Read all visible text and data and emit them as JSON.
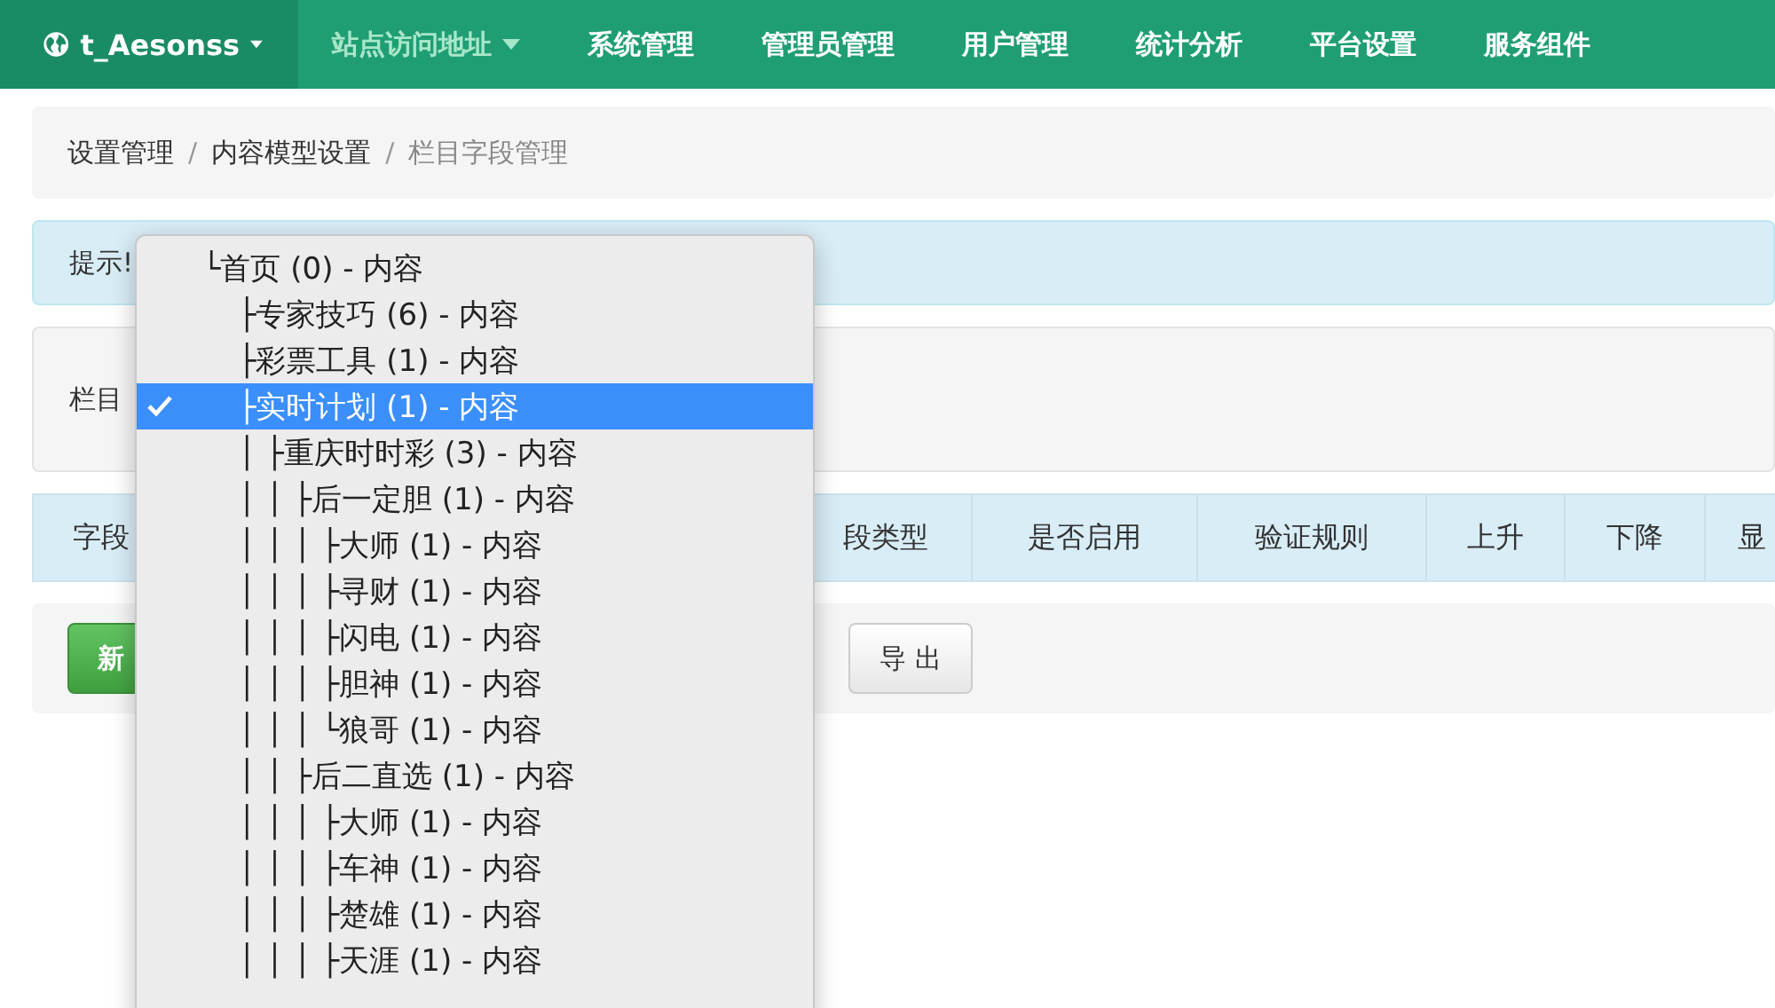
{
  "navbar": {
    "brand": "t_Aesonss",
    "items": [
      {
        "label": "站点访问地址",
        "selected": true,
        "dropdown": true
      },
      {
        "label": "系统管理",
        "selected": false,
        "dropdown": false
      },
      {
        "label": "管理员管理",
        "selected": false,
        "dropdown": false
      },
      {
        "label": "用户管理",
        "selected": false,
        "dropdown": false
      },
      {
        "label": "统计分析",
        "selected": false,
        "dropdown": false
      },
      {
        "label": "平台设置",
        "selected": false,
        "dropdown": false
      },
      {
        "label": "服务组件",
        "selected": false,
        "dropdown": false
      }
    ]
  },
  "breadcrumb": [
    "设置管理",
    "内容模型设置",
    "栏目字段管理"
  ],
  "breadcrumb_separator": "/",
  "alert": {
    "text": "提示!"
  },
  "filter": {
    "label": "栏目"
  },
  "table": {
    "columns": [
      "字段",
      "段类型",
      "是否启用",
      "验证规则",
      "上升",
      "下降",
      "显"
    ]
  },
  "buttons": [
    {
      "label": "新",
      "kind": "primary"
    },
    {
      "label": "导 出",
      "kind": "default"
    }
  ],
  "dropdown": {
    "items": [
      {
        "label": "└首页 (0) - 内容",
        "selected": false,
        "children": [
          {
            "label": "├专家技巧 (6) - 内容",
            "selected": false
          },
          {
            "label": "├彩票工具 (1) - 内容",
            "selected": false
          },
          {
            "label": "├实时计划 (1) - 内容",
            "selected": true,
            "children": [
              {
                "label": "│ ├重庆时时彩 (3) - 内容",
                "selected": false,
                "children": [
                  {
                    "label": "│ │ ├后一定胆 (1) - 内容",
                    "selected": false,
                    "children": [
                      {
                        "label": "│ │ │ ├大师 (1) - 内容",
                        "selected": false
                      },
                      {
                        "label": "│ │ │ ├寻财 (1) - 内容",
                        "selected": false
                      },
                      {
                        "label": "│ │ │ ├闪电 (1) - 内容",
                        "selected": false
                      },
                      {
                        "label": "│ │ │ ├胆神 (1) - 内容",
                        "selected": false
                      },
                      {
                        "label": "│ │ │ └狼哥 (1) - 内容",
                        "selected": false
                      }
                    ]
                  },
                  {
                    "label": "│ │ ├后二直选 (1) - 内容",
                    "selected": false,
                    "children": [
                      {
                        "label": "│ │ │ ├大师 (1) - 内容",
                        "selected": false
                      },
                      {
                        "label": "│ │ │ ├车神 (1) - 内容",
                        "selected": false
                      },
                      {
                        "label": "│ │ │ ├楚雄 (1) - 内容",
                        "selected": false
                      },
                      {
                        "label": "│ │ │ ├天涯 (1) - 内容",
                        "selected": false
                      }
                    ]
                  }
                ]
              }
            ]
          }
        ]
      }
    ]
  }
}
